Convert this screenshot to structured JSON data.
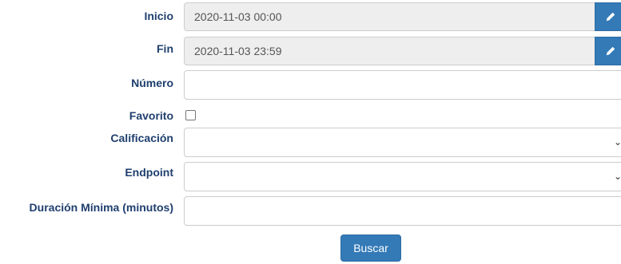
{
  "form": {
    "inicio": {
      "label": "Inicio",
      "value": "2020-11-03 00:00"
    },
    "fin": {
      "label": "Fin",
      "value": "2020-11-03 23:59"
    },
    "numero": {
      "label": "Número",
      "value": ""
    },
    "favorito": {
      "label": "Favorito",
      "checked": false
    },
    "calificacion": {
      "label": "Calificación",
      "value": ""
    },
    "endpoint": {
      "label": "Endpoint",
      "value": ""
    },
    "duracion": {
      "label": "Duración Mínima (minutos)",
      "value": ""
    },
    "search_button": "Buscar"
  },
  "icons": {
    "edit": "pencil-icon",
    "select": "chevron-down-icon"
  },
  "colors": {
    "label": "#1f3f6e",
    "primary": "#337ab7",
    "readonly_bg": "#eeeeee",
    "border": "#cccccc"
  }
}
